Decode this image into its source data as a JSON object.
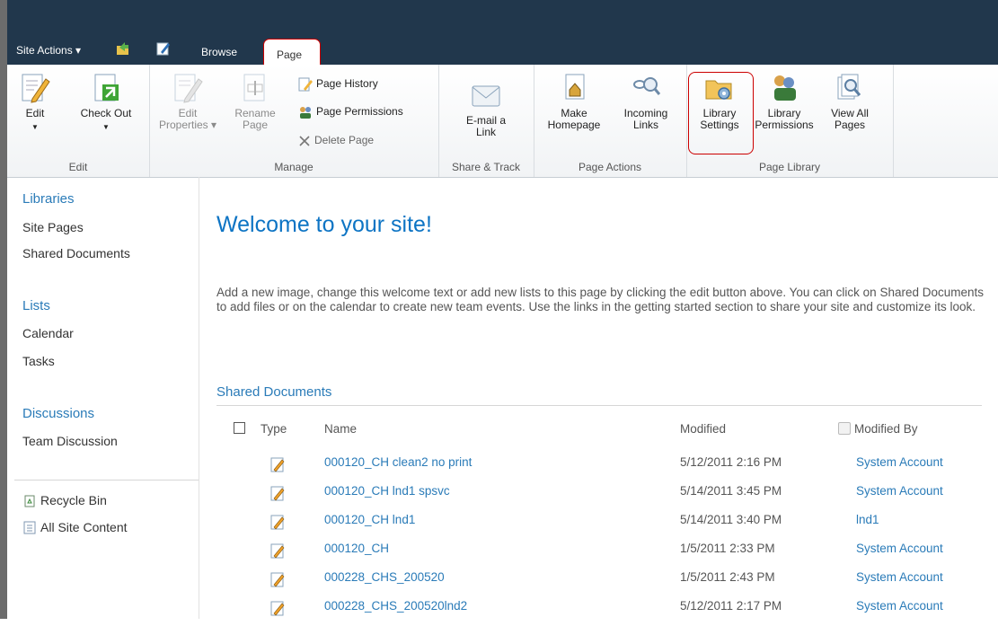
{
  "topbar": {
    "site_actions": "Site Actions ▾",
    "tabs": [
      {
        "label": "Browse"
      },
      {
        "label": "Page"
      }
    ]
  },
  "ribbon": {
    "groups": [
      {
        "label": "Edit"
      },
      {
        "label": "Manage"
      },
      {
        "label": "Share & Track"
      },
      {
        "label": "Page Actions"
      },
      {
        "label": "Page Library"
      }
    ],
    "edit": {
      "label": "Edit"
    },
    "check_out": {
      "label": "Check Out"
    },
    "edit_properties": {
      "line1": "Edit",
      "line2": "Properties"
    },
    "rename_page": {
      "line1": "Rename",
      "line2": "Page"
    },
    "page_history": "Page History",
    "page_permissions": "Page Permissions",
    "delete_page": "Delete Page",
    "email_link": {
      "line1": "E-mail a",
      "line2": "Link"
    },
    "make_homepage": {
      "line1": "Make",
      "line2": "Homepage"
    },
    "incoming_links": {
      "line1": "Incoming",
      "line2": "Links"
    },
    "library_settings": {
      "line1": "Library",
      "line2": "Settings"
    },
    "library_permissions": {
      "line1": "Library",
      "line2": "Permissions"
    },
    "view_all_pages": {
      "line1": "View All",
      "line2": "Pages"
    }
  },
  "nav": {
    "libraries_head": "Libraries",
    "libraries": [
      "Site Pages",
      "Shared Documents"
    ],
    "lists_head": "Lists",
    "lists": [
      "Calendar",
      "Tasks"
    ],
    "discussions_head": "Discussions",
    "discussions": [
      "Team Discussion"
    ],
    "recycle_bin": "Recycle Bin",
    "all_site_content": "All Site Content"
  },
  "main": {
    "title": "Welcome to your site!",
    "paragraph": "Add a new image, change this welcome text or add new lists to this page by clicking the edit button above. You can click on Shared Documents to add files or on the calendar to create new team events. Use the links in the getting started section to share your site and customize its look.",
    "webpart_title": "Shared Documents",
    "columns": {
      "type": "Type",
      "name": "Name",
      "modified": "Modified",
      "modified_by": "Modified By"
    },
    "rows": [
      {
        "name": "000120_CH clean2 no print",
        "modified": "5/12/2011 2:16 PM",
        "modified_by": "System Account"
      },
      {
        "name": "000120_CH lnd1 spsvc",
        "modified": "5/14/2011 3:45 PM",
        "modified_by": "System Account"
      },
      {
        "name": "000120_CH lnd1",
        "modified": "5/14/2011 3:40 PM",
        "modified_by": "lnd1"
      },
      {
        "name": "000120_CH",
        "modified": "1/5/2011 2:33 PM",
        "modified_by": "System Account"
      },
      {
        "name": "000228_CHS_200520",
        "modified": "1/5/2011 2:43 PM",
        "modified_by": "System Account"
      },
      {
        "name": "000228_CHS_200520lnd2",
        "modified": "5/12/2011 2:17 PM",
        "modified_by": "System Account"
      }
    ]
  },
  "colors": {
    "accent": "#0d74c4",
    "link": "#2a7bb8",
    "titlebar": "#21374c",
    "highlight": "#cc0000"
  }
}
